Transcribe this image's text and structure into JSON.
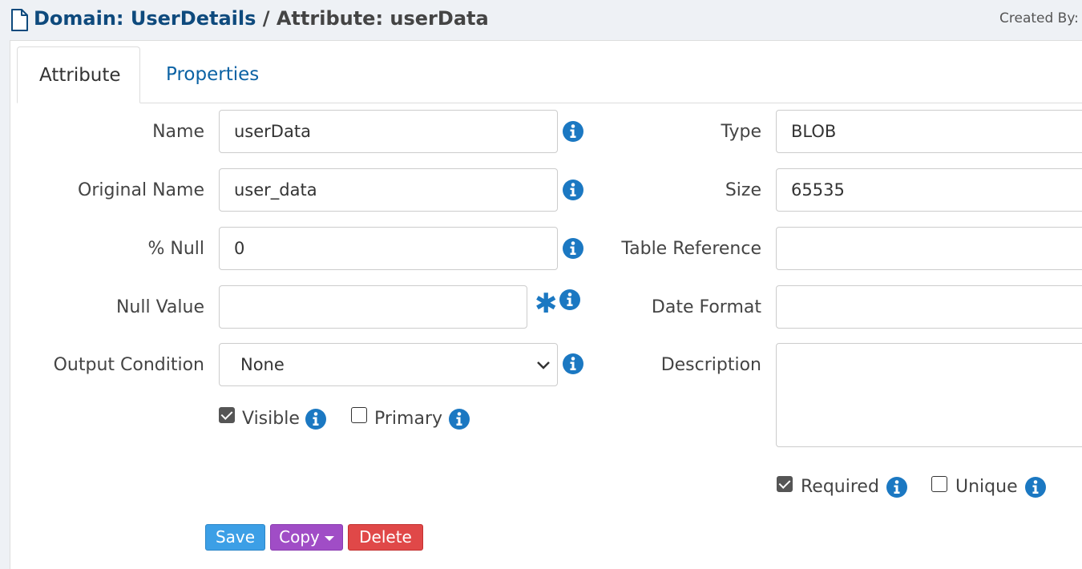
{
  "header": {
    "domain_title": "Domain: UserDetails",
    "separator": " / ",
    "attribute_title": "Attribute: userData",
    "created_by": "Created By: A"
  },
  "tabs": [
    {
      "label": "Attribute",
      "active": true
    },
    {
      "label": "Properties",
      "active": false
    }
  ],
  "form": {
    "name": {
      "label": "Name",
      "value": "userData"
    },
    "original_name": {
      "label": "Original Name",
      "value": "user_data"
    },
    "percent_null": {
      "label": "% Null",
      "value": "0"
    },
    "null_value": {
      "label": "Null Value",
      "value": ""
    },
    "output_condition": {
      "label": "Output Condition",
      "value": "None"
    },
    "visible": {
      "label": "Visible",
      "checked": true
    },
    "primary": {
      "label": "Primary",
      "checked": false
    },
    "type": {
      "label": "Type",
      "value": "BLOB"
    },
    "size": {
      "label": "Size",
      "value": "65535"
    },
    "table_reference": {
      "label": "Table Reference",
      "value": ""
    },
    "date_format": {
      "label": "Date Format",
      "value": ""
    },
    "description": {
      "label": "Description",
      "value": ""
    },
    "required": {
      "label": "Required",
      "checked": true
    },
    "unique": {
      "label": "Unique",
      "checked": false
    }
  },
  "actions": {
    "save": "Save",
    "copy": "Copy",
    "delete": "Delete"
  },
  "colors": {
    "brand_title": "#0e4a7d",
    "link": "#0b62a4",
    "info_icon": "#1b78c2",
    "save": "#3c9fe6",
    "copy": "#a04dc6",
    "delete": "#e04848"
  },
  "icons": {
    "document": "file-icon",
    "info": "info-icon",
    "required_marker": "asterisk-icon",
    "dropdown": "chevron-down-icon"
  }
}
